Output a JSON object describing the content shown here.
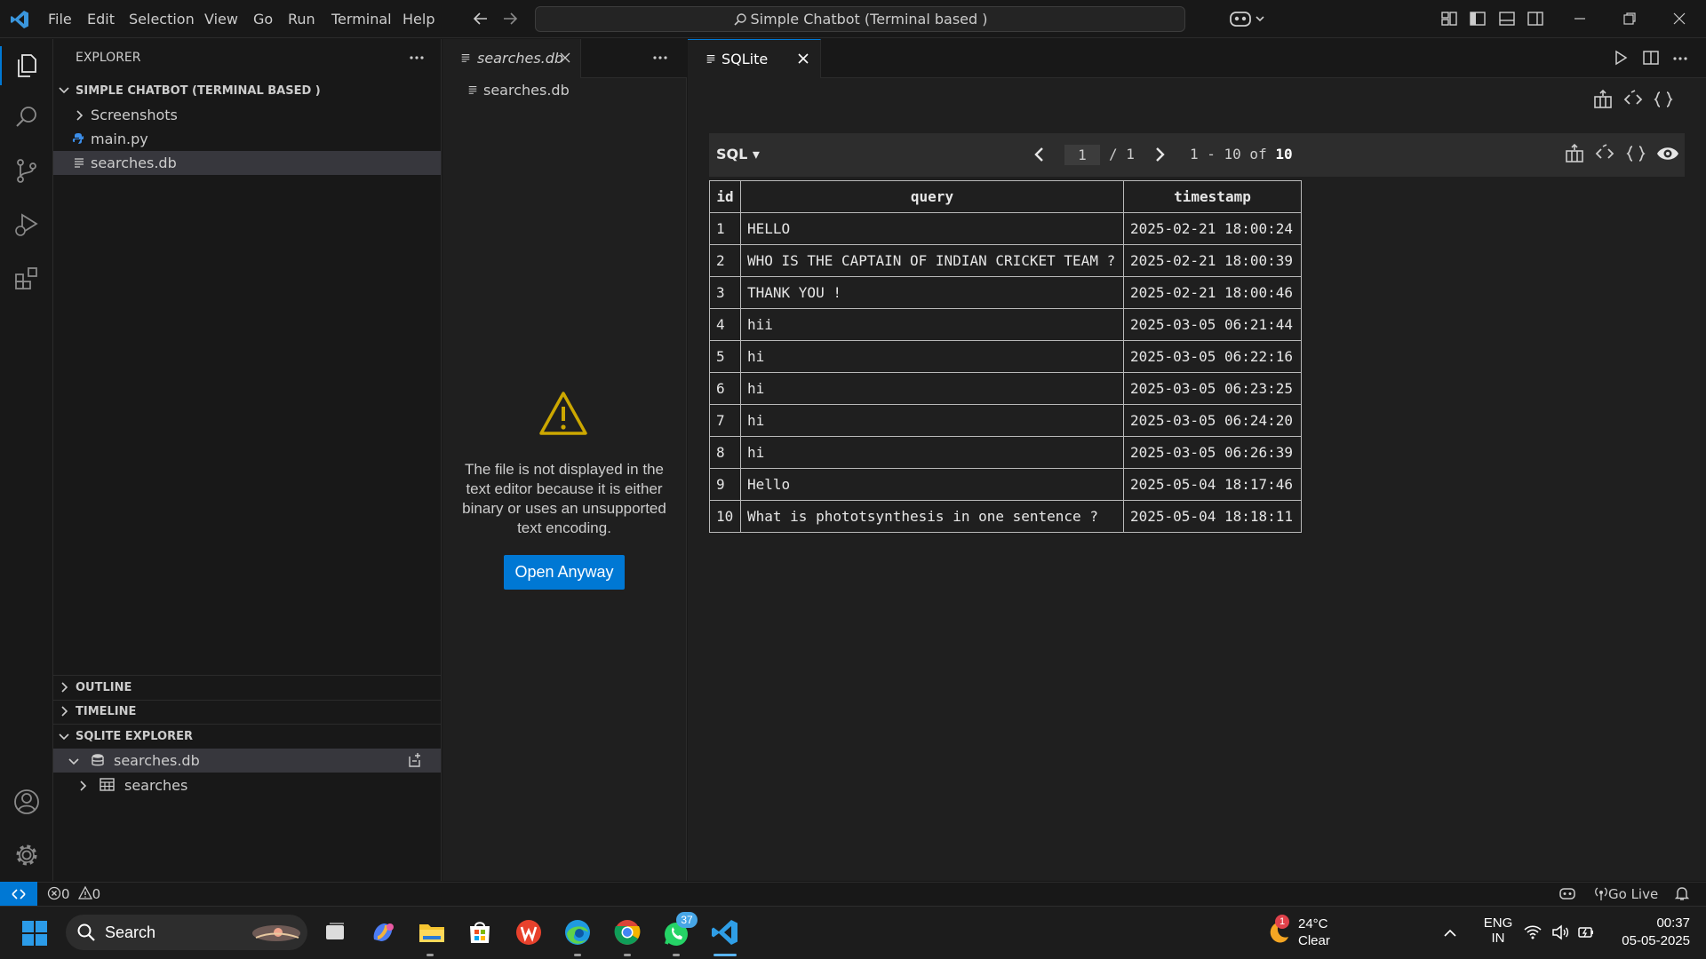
{
  "menu": [
    "File",
    "Edit",
    "Selection",
    "View",
    "Go",
    "Run",
    "Terminal",
    "Help"
  ],
  "command_center": "Simple Chatbot (Terminal based )",
  "explorer": {
    "title": "EXPLORER",
    "folder": "SIMPLE CHATBOT (TERMINAL BASED )",
    "items": [
      "Screenshots",
      "main.py",
      "searches.db"
    ]
  },
  "sections": {
    "outline": "OUTLINE",
    "timeline": "TIMELINE",
    "sqlite_explorer": "SQLITE EXPLORER"
  },
  "sqlite_tree": {
    "db": "searches.db",
    "table": "searches"
  },
  "group1": {
    "tab": "searches.db",
    "breadcrumb": "searches.db",
    "message": "The file is not displayed in the text editor because it is either binary or uses an unsupported text encoding.",
    "button": "Open Anyway"
  },
  "group2": {
    "tab": "SQLite",
    "sql_label": "SQL",
    "page": "1",
    "page_total": "/ 1",
    "range_prefix": "1 - 10 of",
    "range_total": "10",
    "columns": [
      "id",
      "query",
      "timestamp"
    ],
    "rows": [
      [
        "1",
        "HELLO",
        "2025-02-21 18:00:24"
      ],
      [
        "2",
        "WHO IS THE CAPTAIN OF INDIAN CRICKET TEAM ?",
        "2025-02-21 18:00:39"
      ],
      [
        "3",
        "THANK YOU !",
        "2025-02-21 18:00:46"
      ],
      [
        "4",
        "hii",
        "2025-03-05 06:21:44"
      ],
      [
        "5",
        "hi",
        "2025-03-05 06:22:16"
      ],
      [
        "6",
        "hi",
        "2025-03-05 06:23:25"
      ],
      [
        "7",
        "hi",
        "2025-03-05 06:24:20"
      ],
      [
        "8",
        "hi",
        "2025-03-05 06:26:39"
      ],
      [
        "9",
        "Hello",
        "2025-05-04 18:17:46"
      ],
      [
        "10",
        "What is phototsynthesis in one sentence ?",
        "2025-05-04 18:18:11"
      ]
    ]
  },
  "statusbar": {
    "errors": "0",
    "warnings": "0",
    "go_live": "Go Live"
  },
  "taskbar": {
    "search": "Search",
    "whatsapp_badge": "37",
    "weather_badge": "1",
    "weather_temp": "24°C",
    "weather_desc": "Clear",
    "lang": "ENG",
    "region": "IN",
    "time": "00:37",
    "date": "05-05-2025"
  },
  "colors": {
    "accent": "#0078d4",
    "bg": "#1f1f1f",
    "warning": "#cca700"
  }
}
